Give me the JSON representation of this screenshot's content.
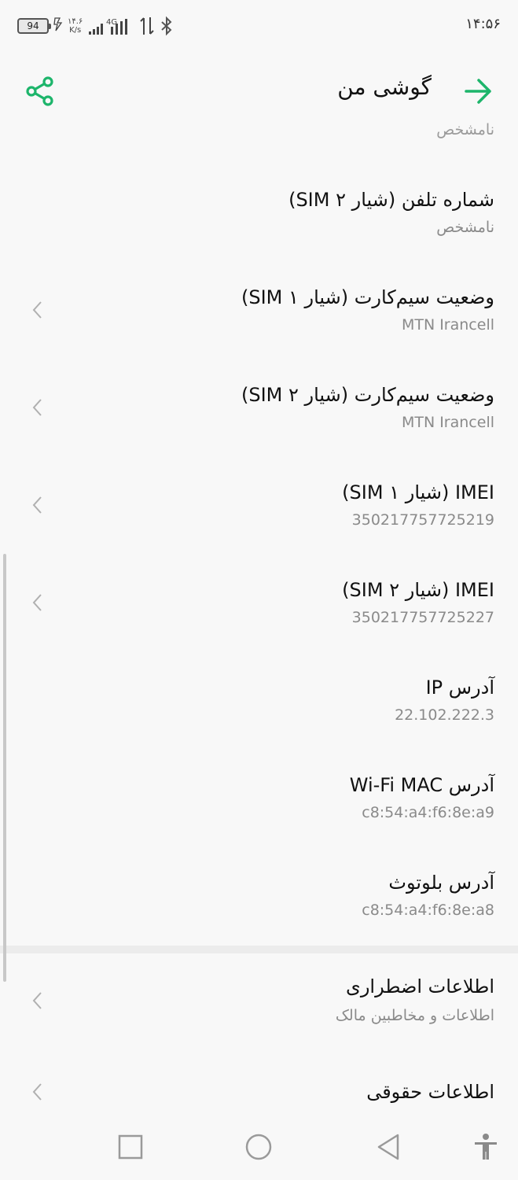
{
  "status_bar": {
    "battery": "94",
    "speed_value": "۱۴.۶",
    "speed_unit": "K/s",
    "network": "4G",
    "time": "۱۴:۵۶"
  },
  "header": {
    "title": "گوشی من",
    "accent_color": "#1db56b"
  },
  "partial_row_text": "نامشخص",
  "rows": [
    {
      "title": "شماره تلفن (شیار ۲ SIM)",
      "subtitle": "نامشخص",
      "chevron": false
    },
    {
      "title": "وضعیت سیم‌کارت (شیار ۱ SIM)",
      "subtitle": "MTN Irancell",
      "chevron": true
    },
    {
      "title": "وضعیت سیم‌کارت (شیار ۲ SIM)",
      "subtitle": "MTN Irancell",
      "chevron": true
    },
    {
      "title": "IMEI (شیار ۱ SIM)",
      "subtitle": "350217757725219",
      "chevron": true
    },
    {
      "title": "IMEI (شیار ۲ SIM)",
      "subtitle": "350217757725227",
      "chevron": true
    },
    {
      "title": "آدرس IP",
      "subtitle": "22.102.222.3",
      "chevron": false
    },
    {
      "title": "آدرس Wi-Fi MAC",
      "subtitle": "c8:54:a4:f6:8e:a9",
      "chevron": false
    },
    {
      "title": "آدرس بلوتوث",
      "subtitle": "c8:54:a4:f6:8e:a8",
      "chevron": false
    },
    {
      "title": "اطلاعات اضطراری",
      "subtitle": "اطلاعات و مخاطبین مالک",
      "chevron": true
    },
    {
      "title": "اطلاعات حقوقی",
      "subtitle": "",
      "chevron": true
    }
  ],
  "icons": {
    "back": "arrow-right-icon",
    "share": "share-icon",
    "chevron": "chevron-left-icon",
    "nav_recent": "square-icon",
    "nav_home": "circle-icon",
    "nav_back": "triangle-back-icon",
    "nav_accessibility": "accessibility-icon"
  }
}
